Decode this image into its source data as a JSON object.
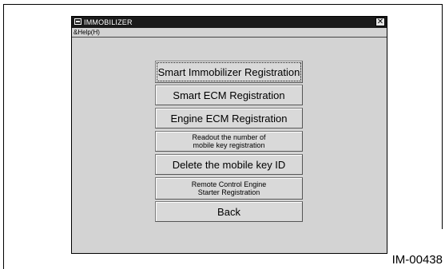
{
  "window": {
    "title": "IMMOBILIZER",
    "close_glyph": "✕"
  },
  "menu": {
    "help": "&Help(H)"
  },
  "buttons": {
    "smart_immobilizer": "Smart Immobilizer Registration",
    "smart_ecm": "Smart ECM Registration",
    "engine_ecm": "Engine ECM Registration",
    "readout_line1": "Readout the number of",
    "readout_line2": "mobile key registration",
    "delete_mobile_key": "Delete the mobile key ID",
    "remote_line1": "Remote Control Engine",
    "remote_line2": "Starter Registration",
    "back": "Back"
  },
  "figure": {
    "id": "IM-00438"
  }
}
